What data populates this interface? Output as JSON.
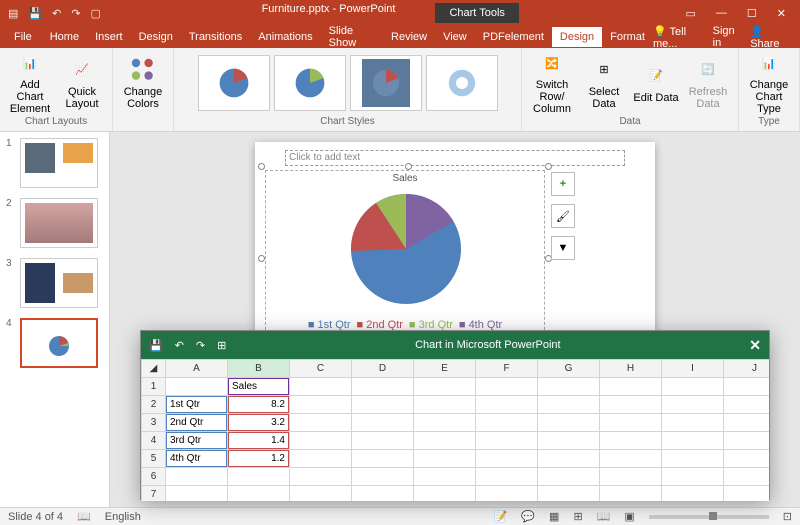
{
  "titlebar": {
    "filename": "Furniture.pptx - PowerPoint",
    "context_tab": "Chart Tools"
  },
  "menubar": {
    "tabs": [
      "File",
      "Home",
      "Insert",
      "Design",
      "Transitions",
      "Animations",
      "Slide Show",
      "Review",
      "View",
      "PDFelement",
      "Design",
      "Format"
    ],
    "active_index": 10,
    "tell_me": "Tell me...",
    "signin": "Sign in",
    "share": "Share"
  },
  "ribbon": {
    "add_chart_element": "Add Chart Element",
    "quick_layout": "Quick Layout",
    "change_colors": "Change Colors",
    "group_layouts": "Chart Layouts",
    "group_styles": "Chart Styles",
    "switch_row_col": "Switch Row/ Column",
    "select_data": "Select Data",
    "edit_data": "Edit Data",
    "refresh_data": "Refresh Data",
    "group_data": "Data",
    "change_chart_type": "Change Chart Type",
    "group_type": "Type"
  },
  "slides": [
    {
      "num": "1"
    },
    {
      "num": "2"
    },
    {
      "num": "3"
    },
    {
      "num": "4"
    }
  ],
  "active_slide": 3,
  "canvas": {
    "placeholder": "Click to add text",
    "chart_title": "Sales",
    "legend": [
      "1st Qtr",
      "2nd Qtr",
      "3rd Qtr",
      "4th Qtr"
    ]
  },
  "excel": {
    "title": "Chart in Microsoft PowerPoint",
    "columns": [
      "A",
      "B",
      "C",
      "D",
      "E",
      "F",
      "G",
      "H",
      "I",
      "J"
    ],
    "header_row": {
      "b": "Sales"
    },
    "rows": [
      {
        "n": "2",
        "a": "1st Qtr",
        "b": "8.2"
      },
      {
        "n": "3",
        "a": "2nd Qtr",
        "b": "3.2"
      },
      {
        "n": "4",
        "a": "3rd Qtr",
        "b": "1.4"
      },
      {
        "n": "5",
        "a": "4th Qtr",
        "b": "1.2"
      },
      {
        "n": "6",
        "a": "",
        "b": ""
      },
      {
        "n": "7",
        "a": "",
        "b": ""
      }
    ]
  },
  "statusbar": {
    "slide_info": "Slide 4 of 4",
    "language": "English"
  },
  "chart_data": {
    "type": "pie",
    "title": "Sales",
    "categories": [
      "1st Qtr",
      "2nd Qtr",
      "3rd Qtr",
      "4th Qtr"
    ],
    "values": [
      8.2,
      3.2,
      1.4,
      1.2
    ],
    "colors": [
      "#4f81bd",
      "#c0504d",
      "#9bbb59",
      "#8064a2"
    ]
  }
}
